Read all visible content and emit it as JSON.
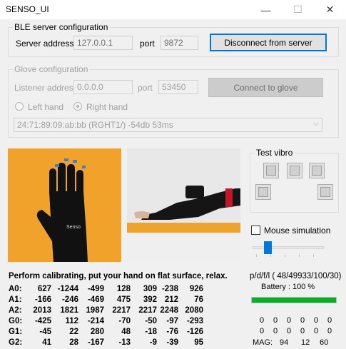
{
  "window": {
    "title": "SENSO_UI",
    "controls": {
      "minimize": "—",
      "maximize": "☐",
      "close": "✕"
    }
  },
  "ble": {
    "legend": "BLE server configuration",
    "server_label": "Server address",
    "server_value": "127.0.0.1",
    "port_label": "port",
    "port_value": "9872",
    "button": "Disconnect from server"
  },
  "glove": {
    "legend": "Glove configuration",
    "listener_label": "Listener address",
    "listener_value": "0.0.0.0",
    "port_label": "port",
    "port_value": "53450",
    "button": "Connect to glove",
    "left_hand": "Left hand",
    "right_hand": "Right hand",
    "selected_hand": "Right hand",
    "device": "24:71:89:09:ab:bb (RGHT1/) -54db 53ms"
  },
  "vibro": {
    "legend": "Test vibro"
  },
  "mouse_sim": {
    "label": "Mouse simulation",
    "checked": false
  },
  "slider": {
    "value_fraction": 0.2
  },
  "status": {
    "message": "Perform calibrating, put your hand on flat surface, relax.",
    "packets": "p/d/f/l ( 48/49933/100/30)",
    "battery": "Battery : 100 %",
    "battery_level": 1.0
  },
  "sensors": [
    {
      "label": "A0:",
      "values": [
        "627",
        "-1244",
        "-499",
        "128",
        "309",
        "-238",
        "926"
      ]
    },
    {
      "label": "A1:",
      "values": [
        "-166",
        "-246",
        "-469",
        "475",
        "392",
        "212",
        "76"
      ]
    },
    {
      "label": "A2:",
      "values": [
        "2013",
        "1821",
        "1987",
        "2217",
        "2217",
        "2248",
        "2080"
      ]
    },
    {
      "label": "G0:",
      "values": [
        "-425",
        "112",
        "-214",
        "-70",
        "-50",
        "-97",
        "-293"
      ]
    },
    {
      "label": "G1:",
      "values": [
        "-45",
        "22",
        "280",
        "48",
        "-18",
        "-76",
        "-126"
      ]
    },
    {
      "label": "G2:",
      "values": [
        "41",
        "28",
        "-167",
        "-13",
        "-9",
        "-39",
        "95"
      ]
    }
  ],
  "right_grid": [
    [
      "0",
      "0",
      "0",
      "0",
      "0",
      "0"
    ],
    [
      "0",
      "0",
      "0",
      "0",
      "0",
      "0"
    ]
  ],
  "mag": {
    "label": "MAG:",
    "values": [
      "94",
      "12",
      "60"
    ]
  },
  "colors": {
    "accent": "#0078d7",
    "battery": "#06b025",
    "photo_bg": "#f0a32c"
  }
}
